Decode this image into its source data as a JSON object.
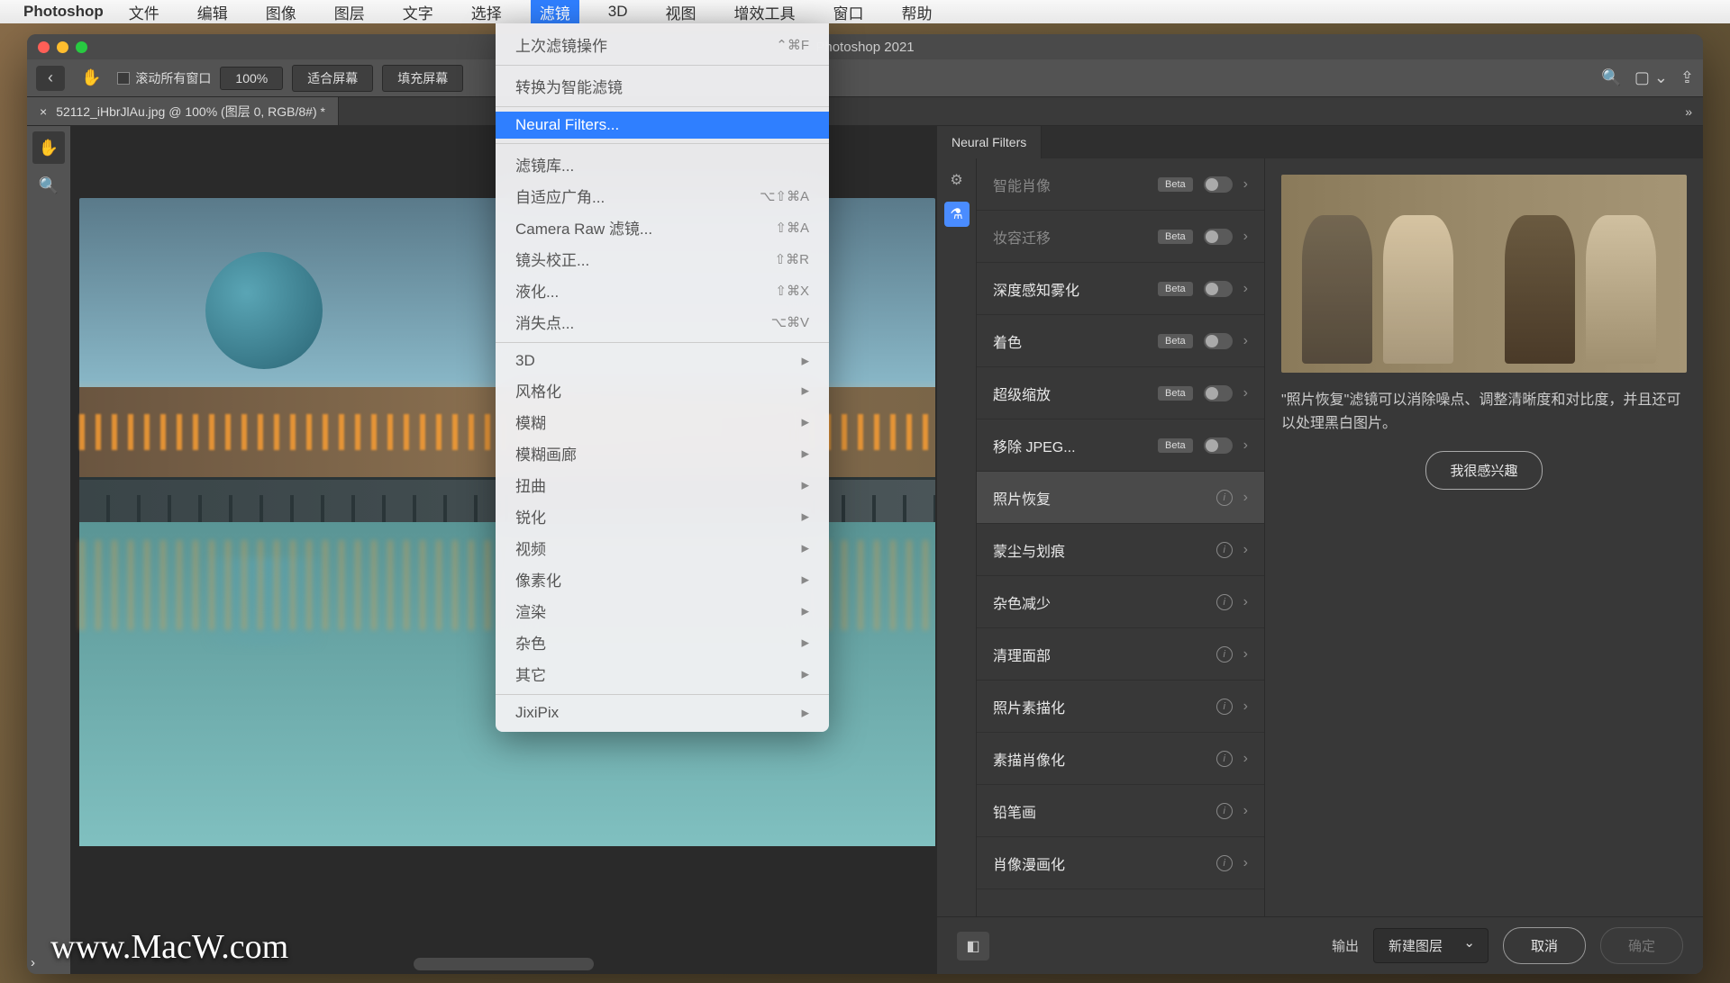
{
  "menubar": {
    "app": "Photoshop",
    "items": [
      "文件",
      "编辑",
      "图像",
      "图层",
      "文字",
      "选择",
      "滤镜",
      "3D",
      "视图",
      "增效工具",
      "窗口",
      "帮助"
    ],
    "active_index": 6
  },
  "titlebar": {
    "title": "Photoshop 2021"
  },
  "toolbar": {
    "scroll_all": "滚动所有窗口",
    "zoom": "100%",
    "fit": "适合屏幕",
    "fill": "填充屏幕"
  },
  "document_tab": {
    "label": "52112_iHbrJlAu.jpg @ 100% (图层 0, RGB/8#) *"
  },
  "dropdown": {
    "groups": [
      [
        {
          "label": "上次滤镜操作",
          "shortcut": "⌃⌘F",
          "enabled": false
        }
      ],
      [
        {
          "label": "转换为智能滤镜",
          "enabled": false
        }
      ],
      [
        {
          "label": "Neural Filters...",
          "enabled": true,
          "highlighted": true
        }
      ],
      [
        {
          "label": "滤镜库...",
          "enabled": false
        },
        {
          "label": "自适应广角...",
          "shortcut": "⌥⇧⌘A",
          "enabled": false
        },
        {
          "label": "Camera Raw 滤镜...",
          "shortcut": "⇧⌘A",
          "enabled": false
        },
        {
          "label": "镜头校正...",
          "shortcut": "⇧⌘R",
          "enabled": false
        },
        {
          "label": "液化...",
          "shortcut": "⇧⌘X",
          "enabled": false
        },
        {
          "label": "消失点...",
          "shortcut": "⌥⌘V",
          "enabled": false
        }
      ],
      [
        {
          "label": "3D",
          "submenu": true,
          "enabled": false
        },
        {
          "label": "风格化",
          "submenu": true,
          "enabled": false
        },
        {
          "label": "模糊",
          "submenu": true,
          "enabled": false
        },
        {
          "label": "模糊画廊",
          "submenu": true,
          "enabled": false
        },
        {
          "label": "扭曲",
          "submenu": true,
          "enabled": false
        },
        {
          "label": "锐化",
          "submenu": true,
          "enabled": false
        },
        {
          "label": "视频",
          "submenu": true,
          "enabled": false
        },
        {
          "label": "像素化",
          "submenu": true,
          "enabled": false
        },
        {
          "label": "渲染",
          "submenu": true,
          "enabled": false
        },
        {
          "label": "杂色",
          "submenu": true,
          "enabled": false
        },
        {
          "label": "其它",
          "submenu": true,
          "enabled": false
        }
      ],
      [
        {
          "label": "JixiPix",
          "submenu": true,
          "enabled": false
        }
      ]
    ]
  },
  "neural_panel": {
    "tab": "Neural Filters",
    "filters": [
      {
        "name": "智能肖像",
        "beta": true,
        "toggle": true,
        "dimmed": true
      },
      {
        "name": "妆容迁移",
        "beta": true,
        "toggle": true,
        "dimmed": true
      },
      {
        "name": "深度感知雾化",
        "beta": true,
        "toggle": true
      },
      {
        "name": "着色",
        "beta": true,
        "toggle": true
      },
      {
        "name": "超级缩放",
        "beta": true,
        "toggle": true
      },
      {
        "name": "移除 JPEG...",
        "beta": true,
        "toggle": true
      },
      {
        "name": "照片恢复",
        "info": true,
        "selected": true
      },
      {
        "name": "蒙尘与划痕",
        "info": true
      },
      {
        "name": "杂色减少",
        "info": true
      },
      {
        "name": "清理面部",
        "info": true
      },
      {
        "name": "照片素描化",
        "info": true
      },
      {
        "name": "素描肖像化",
        "info": true
      },
      {
        "name": "铅笔画",
        "info": true
      },
      {
        "name": "肖像漫画化",
        "info": true
      }
    ],
    "detail": {
      "description": "\"照片恢复\"滤镜可以消除噪点、调整清晰度和对比度，并且还可以处理黑白图片。",
      "interest_button": "我很感兴趣"
    },
    "footer": {
      "output_label": "输出",
      "output_value": "新建图层",
      "cancel": "取消",
      "ok": "确定"
    }
  },
  "watermark": "www.MacW.com"
}
